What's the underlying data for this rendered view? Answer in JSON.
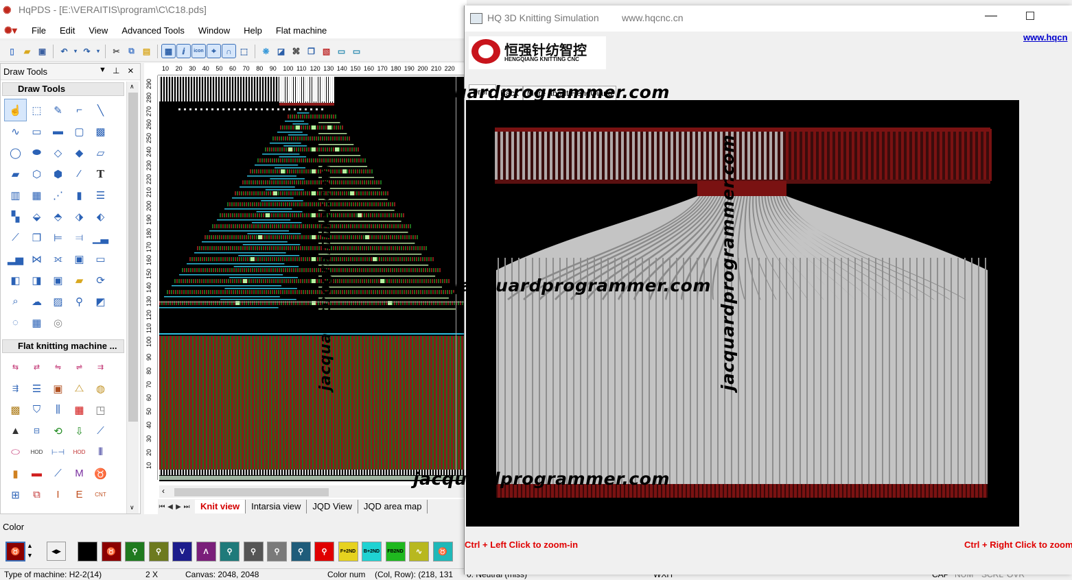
{
  "app": {
    "title": "HqPDS - [E:\\VERAITIS\\program\\C\\C18.pds]",
    "icon": "app-logo-icon"
  },
  "menu": [
    "File",
    "Edit",
    "View",
    "Advanced Tools",
    "Window",
    "Help",
    "Flat machine"
  ],
  "draw_panel": {
    "title": "Draw Tools",
    "section1": "Draw Tools",
    "section2": "Flat knitting machine ..."
  },
  "ruler": {
    "h": [
      "10",
      "20",
      "30",
      "40",
      "50",
      "60",
      "70",
      "80",
      "90",
      "100",
      "110",
      "120",
      "130",
      "140",
      "150",
      "160",
      "170",
      "180",
      "190",
      "200",
      "210",
      "220"
    ],
    "v": [
      "290",
      "280",
      "270",
      "260",
      "250",
      "240",
      "230",
      "220",
      "210",
      "200",
      "190",
      "180",
      "170",
      "160",
      "150",
      "140",
      "130",
      "120",
      "110",
      "100",
      "90",
      "80",
      "70",
      "60",
      "50",
      "40",
      "30",
      "20",
      "10"
    ]
  },
  "view_tabs": [
    "Knit view",
    "Intarsia view",
    "JQD View",
    "JQD area map"
  ],
  "color_label": "Color",
  "color_swatches": [
    {
      "code": "",
      "color": "#000000"
    },
    {
      "code": "♉",
      "color": "#8b0000"
    },
    {
      "code": "⚲",
      "color": "#1f7a1f"
    },
    {
      "code": "⚲",
      "color": "#6d7a1f"
    },
    {
      "code": "V",
      "color": "#1c1c8c"
    },
    {
      "code": "Λ",
      "color": "#7a1f7a"
    },
    {
      "code": "⚲",
      "color": "#1f7a7a"
    },
    {
      "code": "⚲",
      "color": "#555555"
    },
    {
      "code": "⚲",
      "color": "#7a7a7a"
    },
    {
      "code": "⚲",
      "color": "#1f5c7a"
    },
    {
      "code": "⚲",
      "color": "#e00000"
    },
    {
      "code": "F+2ND",
      "color": "#e6d21f"
    },
    {
      "code": "B+2ND",
      "color": "#1fd2d2"
    },
    {
      "code": "FB2ND",
      "color": "#1fb81f"
    },
    {
      "code": "∿",
      "color": "#b8b81f"
    },
    {
      "code": "♉",
      "color": "#1fb8b8"
    }
  ],
  "status": {
    "machine": "Type of machine: H2-2(14)",
    "zoom": "2 X",
    "canvas": "Canvas: 2048, 2048",
    "colnum": "Color num",
    "colrow": "(Col, Row): (218, 131",
    "neutral": "0. Neutral (miss)",
    "wxh": "WXH",
    "cap": "CAP",
    "num": "NUM",
    "scrl": "SCRL",
    "ovr": "OVR"
  },
  "sim": {
    "title": "HQ 3D Knitting Simulation",
    "url": "www.hqcnc.cn",
    "link": "www.hqcn",
    "logo_cn": "恒强针纺智控",
    "logo_en": "HENGQIANG KNITTING CNC",
    "tabs": [
      "Front",
      "Back",
      "More about HengQiang"
    ],
    "hint_left": "Ctrl + Left Click to zoom-in",
    "hint_right": "Ctrl + Right Click to zoom"
  },
  "watermark": "jacquardprogrammer.com",
  "colors": {
    "knit_red": "#8b1a1a",
    "knit_green": "#1e6e1e",
    "knit_cyan": "#2fc0e0",
    "fabric_gray": "#bdbdbd",
    "fabric_red": "#7a1212"
  }
}
